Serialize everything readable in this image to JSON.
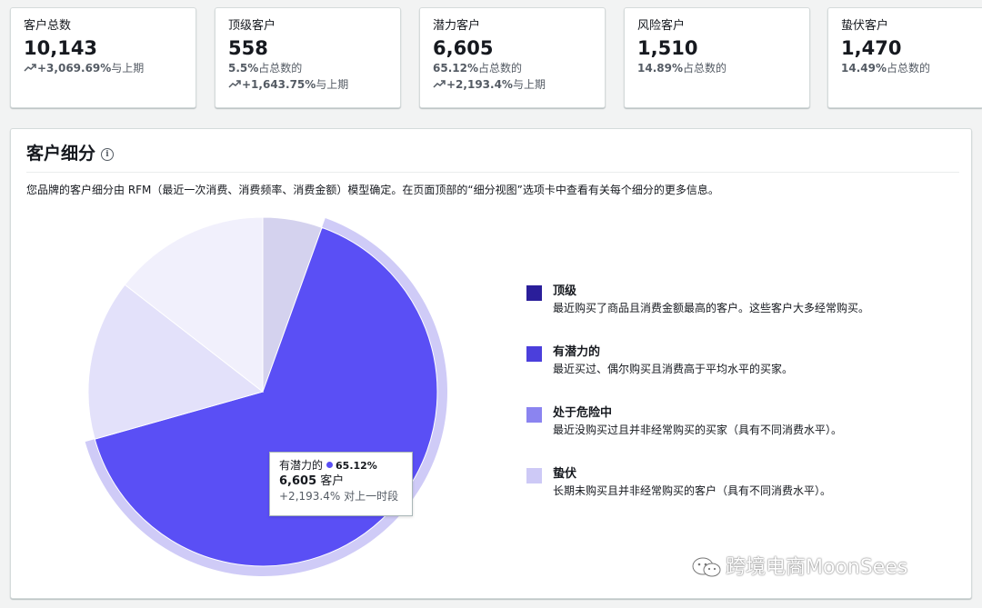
{
  "stats": [
    {
      "title": "客户总数",
      "value": "10,143",
      "line1": "",
      "line2_pct": "+3,069.69%",
      "line2_suffix": "与上期"
    },
    {
      "title": "顶级客户",
      "value": "558",
      "line1_pct": "5.5%",
      "line1_suffix": "占总数的",
      "line2_pct": "+1,643.75%",
      "line2_suffix": "与上期"
    },
    {
      "title": "潜力客户",
      "value": "6,605",
      "line1_pct": "65.12%",
      "line1_suffix": "占总数的",
      "line2_pct": "+2,193.4%",
      "line2_suffix": "与上期"
    },
    {
      "title": "风险客户",
      "value": "1,510",
      "line1_pct": "14.89%",
      "line1_suffix": "占总数的"
    },
    {
      "title": "蛰伏客户",
      "value": "1,470",
      "line1_pct": "14.49%",
      "line1_suffix": "占总数的"
    }
  ],
  "panel": {
    "title": "客户细分",
    "description": "您品牌的客户细分由 RFM（最近一次消费、消费频率、消费金额）模型确定。在页面顶部的“细分视图”选项卡中查看有关每个细分的更多信息。"
  },
  "legend": [
    {
      "name": "顶级",
      "desc": "最近购买了商品且消费金额最高的客户。这些客户大多经常购买。",
      "color": "#2a1e9a"
    },
    {
      "name": "有潜力的",
      "desc": "最近买过、偶尔购买且消费高于平均水平的买家。",
      "color": "#4b3fdc"
    },
    {
      "name": "处于危险中",
      "desc": "最近没购买过且并非经常购买的买家（具有不同消费水平）。",
      "color": "#8b84f0"
    },
    {
      "name": "蛰伏",
      "desc": "长期未购买且并非经常购买的客户（具有不同消费水平）。",
      "color": "#cdc9f6"
    }
  ],
  "chart_data": {
    "type": "pie",
    "slices": [
      {
        "label": "顶级",
        "value": 5.5,
        "color": "#d4d2ee"
      },
      {
        "label": "有潜力的",
        "value": 65.12,
        "color": "#5a4ff5",
        "highlighted": true
      },
      {
        "label": "处于危险中",
        "value": 14.89,
        "color": "#e3e1fa"
      },
      {
        "label": "蛰伏",
        "value": 14.49,
        "color": "#f1f0fc"
      }
    ],
    "highlight_ring_color": "#cfcbf7"
  },
  "tooltip": {
    "name": "有潜力的",
    "pct": "65.12%",
    "count": "6,605",
    "count_unit": "客户",
    "change": "+2,193.4% 对上一时段"
  },
  "watermark": "跨境电商MoonSees"
}
